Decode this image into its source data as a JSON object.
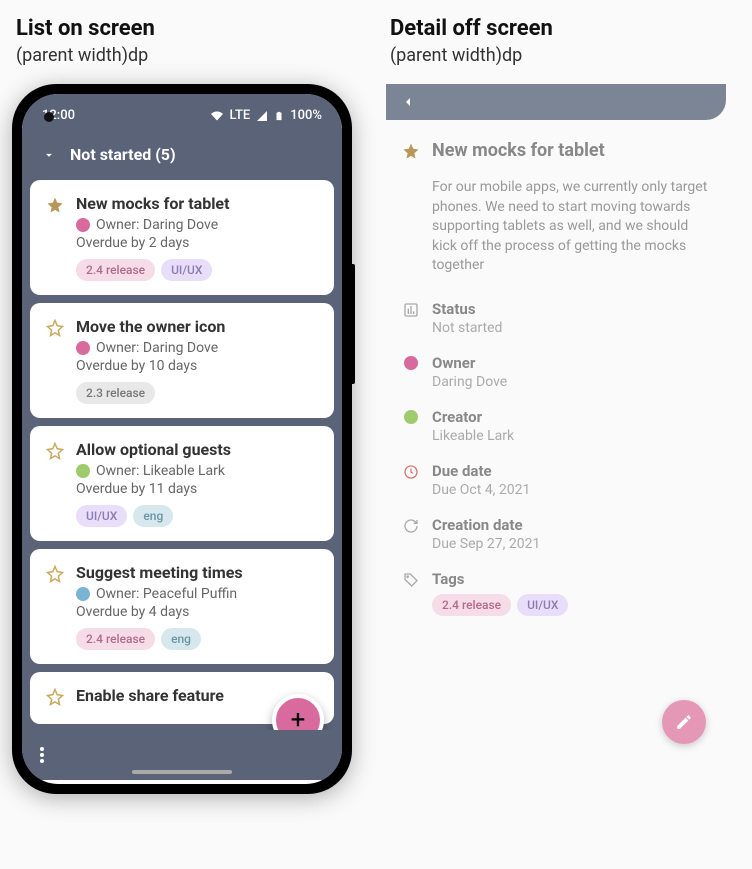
{
  "headings": {
    "left_title": "List on screen",
    "left_sub": "(parent width)dp",
    "right_title": "Detail off screen",
    "right_sub": "(parent width)dp"
  },
  "statusbar": {
    "time": "12:00",
    "lte": "LTE",
    "battery": "100%"
  },
  "header": {
    "title": "Not started (5)"
  },
  "tasks": [
    {
      "title": "New mocks for tablet",
      "owner": "Owner: Daring Dove",
      "owner_color": "pink",
      "due": "Overdue by 2 days",
      "starred": true,
      "tags": [
        {
          "label": "2.4 release",
          "color": "pink"
        },
        {
          "label": "UI/UX",
          "color": "purple"
        }
      ]
    },
    {
      "title": "Move the owner icon",
      "owner": "Owner: Daring Dove",
      "owner_color": "pink",
      "due": "Overdue by 10 days",
      "starred": false,
      "tags": [
        {
          "label": "2.3 release",
          "color": "grey"
        }
      ]
    },
    {
      "title": "Allow optional guests",
      "owner": "Owner: Likeable Lark",
      "owner_color": "green",
      "due": "Overdue by 11 days",
      "starred": false,
      "tags": [
        {
          "label": "UI/UX",
          "color": "purple"
        },
        {
          "label": "eng",
          "color": "blue"
        }
      ]
    },
    {
      "title": "Suggest meeting times",
      "owner": "Owner: Peaceful Puffin",
      "owner_color": "blue",
      "due": "Overdue by 4 days",
      "starred": false,
      "tags": [
        {
          "label": "2.4 release",
          "color": "pink"
        },
        {
          "label": "eng",
          "color": "blue"
        }
      ]
    },
    {
      "title": "Enable share feature",
      "owner": "",
      "owner_color": "",
      "due": "",
      "starred": false,
      "tags": []
    }
  ],
  "detail": {
    "title": "New mocks for tablet",
    "description": "For our mobile apps, we currently only target phones. We need to start moving towards supporting tablets as well, and we should kick off the process of getting the mocks together",
    "rows": {
      "status": {
        "label": "Status",
        "value": "Not started"
      },
      "owner": {
        "label": "Owner",
        "value": "Daring Dove"
      },
      "creator": {
        "label": "Creator",
        "value": "Likeable Lark"
      },
      "due": {
        "label": "Due date",
        "value": "Due Oct 4, 2021"
      },
      "created": {
        "label": "Creation date",
        "value": "Due Sep 27, 2021"
      },
      "tags": {
        "label": "Tags"
      }
    },
    "tags": [
      {
        "label": "2.4 release",
        "color": "pink"
      },
      {
        "label": "UI/UX",
        "color": "purple"
      }
    ]
  }
}
